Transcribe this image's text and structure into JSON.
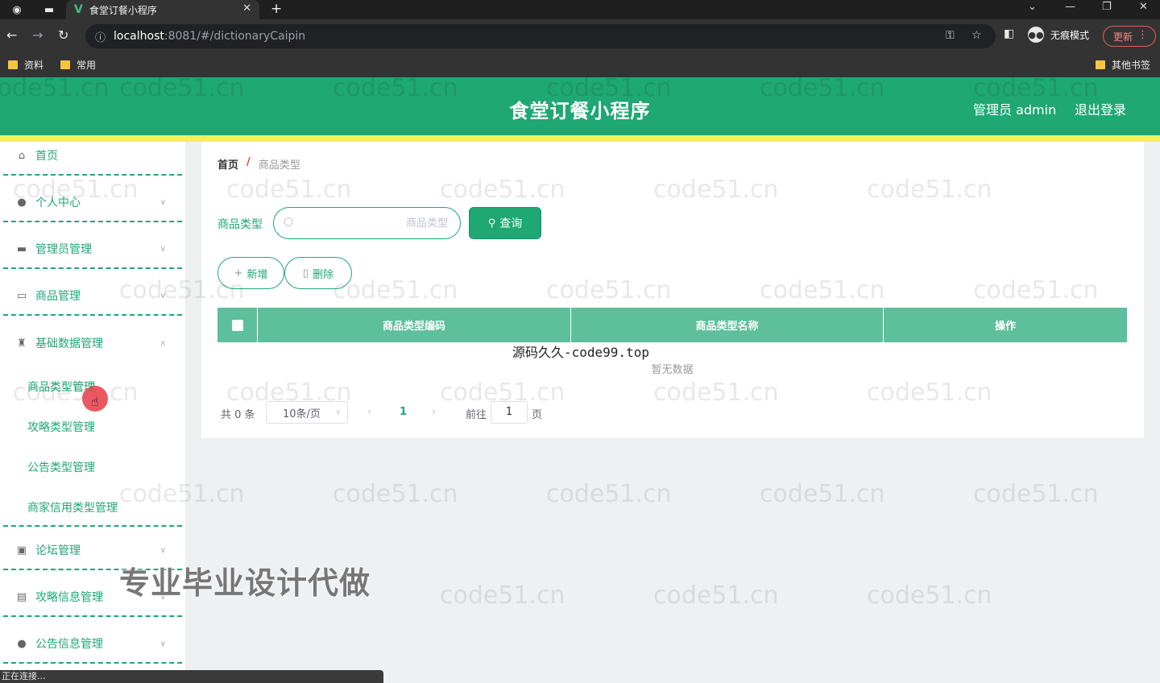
{
  "browser": {
    "tab_title": "食堂订餐小程序",
    "url_host": "localhost",
    "url_rest": ":8081/#/dictionaryCaipin",
    "incognito_label": "无痕模式",
    "update_label": "更新",
    "bookmarks": [
      "资料",
      "常用"
    ],
    "other_bookmarks": "其他书签",
    "status_text": "正在连接..."
  },
  "header": {
    "title": "食堂订餐小程序",
    "admin_label": "管理员 admin",
    "logout_label": "退出登录"
  },
  "sidebar": {
    "items": [
      {
        "label": "首页",
        "icon": "home-icon"
      },
      {
        "label": "个人中心",
        "icon": "user-icon"
      },
      {
        "label": "管理员管理",
        "icon": "briefcase-icon"
      },
      {
        "label": "商品管理",
        "icon": "message-icon"
      },
      {
        "label": "基础数据管理",
        "icon": "trophy-icon"
      },
      {
        "label": "论坛管理",
        "icon": "clipboard-icon"
      },
      {
        "label": "攻略信息管理",
        "icon": "document-icon"
      },
      {
        "label": "公告信息管理",
        "icon": "bulb-icon"
      }
    ],
    "subitems": [
      "商品类型管理",
      "攻略类型管理",
      "公告类型管理",
      "商家信用类型管理"
    ]
  },
  "breadcrumb": {
    "home": "首页",
    "separator": "/",
    "current": "商品类型"
  },
  "search": {
    "label": "商品类型",
    "placeholder": "商品类型",
    "button": "查询"
  },
  "actions": {
    "add": "新增",
    "delete": "删除"
  },
  "table": {
    "columns": [
      "商品类型编码",
      "商品类型名称",
      "操作"
    ],
    "rows": [],
    "empty_text": "暂无数据"
  },
  "pagination": {
    "total_text": "共 0 条",
    "page_size": "10条/页",
    "current_page": "1",
    "goto_label": "前往",
    "goto_value": "1",
    "goto_unit": "页"
  },
  "overlays": {
    "watermark": "code51.cn",
    "code99": "源码久久-code99.top",
    "promo": "专业毕业设计代做"
  },
  "colors": {
    "brand_green": "#1fa774",
    "stripe_yellow": "#f2ef63",
    "table_header": "#5dbf9c"
  }
}
